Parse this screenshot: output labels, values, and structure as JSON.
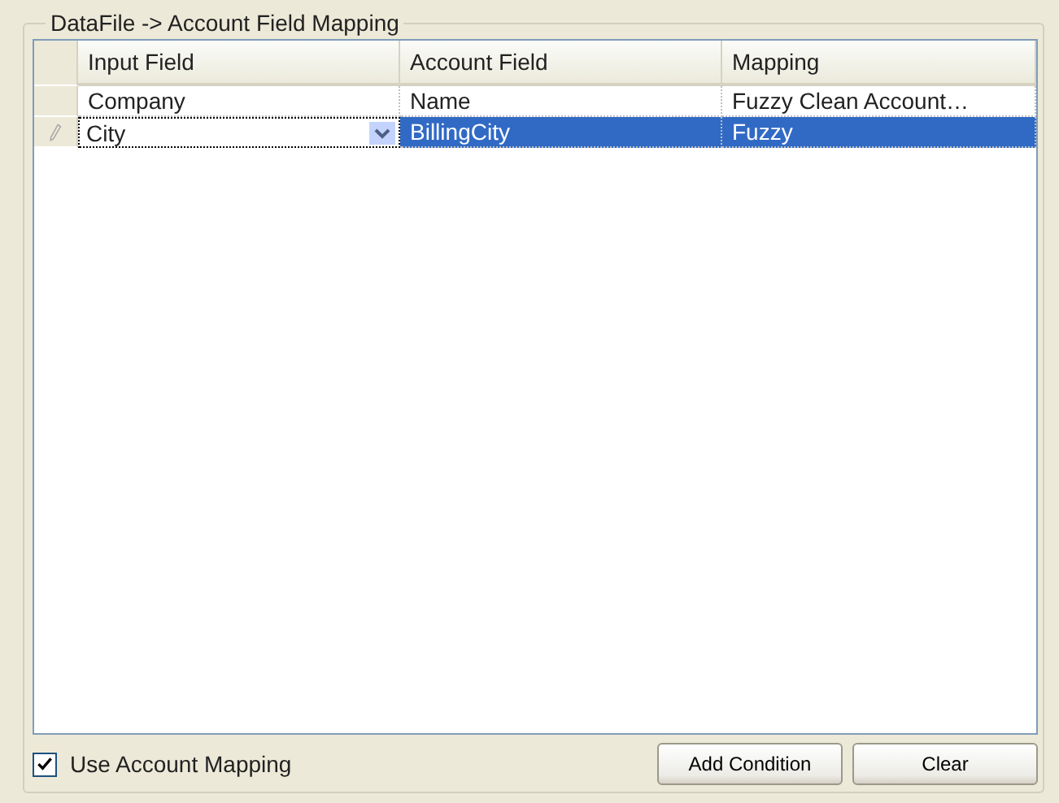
{
  "group": {
    "title": "DataFile -> Account Field Mapping"
  },
  "table": {
    "columns": [
      "Input Field",
      "Account Field",
      "Mapping"
    ],
    "rows": [
      {
        "cells": [
          "Company",
          "Name",
          "Fuzzy Clean Account…"
        ],
        "selected": false,
        "editing": false
      },
      {
        "cells": [
          "City",
          "BillingCity",
          "Fuzzy"
        ],
        "selected": true,
        "editing": true
      }
    ]
  },
  "use_mapping": {
    "label": "Use Account Mapping",
    "checked": true
  },
  "buttons": [
    "Add Condition",
    "Clear"
  ]
}
